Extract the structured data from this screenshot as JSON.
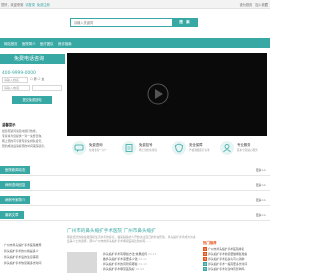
{
  "topbar": {
    "greeting": "您好，欢迎来到",
    "links": [
      "请登录",
      "免费注册"
    ],
    "right_links": [
      "设为首页",
      "加入收藏"
    ]
  },
  "search": {
    "placeholder": "请输入关键词",
    "button_label": "搜 索"
  },
  "nav": {
    "items": [
      "网站首页",
      "医院简介",
      "医疗团队",
      "就诊指南"
    ]
  },
  "sidebar": {
    "phone_title": "免费电话咨询",
    "hotline": "400-9999-0000",
    "name_placeholder": "请输入姓名",
    "phone_placeholder": "请输入电话",
    "radio_labels": [
      "男",
      "女"
    ],
    "submit_label": "提交免费回电",
    "notice_title": "温馨提示",
    "notice_lines": [
      "如您有疑问请及时拨打热线，",
      "专家将为您提供一对一免费咨询，",
      "网上预约可享受专家免排队挂号，",
      "预约成功后请按预约时间来院就诊。"
    ]
  },
  "services": [
    {
      "title": "免费咨询",
      "sub": "在线专家一对一",
      "icon": "chat-icon"
    },
    {
      "title": "免费挂号",
      "sub": "网上预约免排队",
      "icon": "clipboard-icon"
    },
    {
      "title": "安全保障",
      "sub": "严格遵循医疗标准",
      "icon": "shield-icon"
    },
    {
      "title": "专业服务",
      "sub": "医护全程贴心服务",
      "icon": "person-icon"
    }
  ],
  "sections": [
    {
      "label": "医院新闻动态",
      "more": "更多>>"
    },
    {
      "label": "病例咨询回复",
      "more": "更多>>"
    },
    {
      "label": "病例专家简介",
      "more": "更多>>"
    },
    {
      "label": "最新文章",
      "more": "更多>>"
    }
  ],
  "hero": {
    "title": "广州市的鼻头缩扩手术医院 广州市鼻头缩扩",
    "desc": "随着经济的快速发展和生活水平的提高，越来越多的人开始关注自己的外在形象，鼻头缩扩手术成为许多爱美人士的选择，那么广州市的鼻头缩扩手术哪家医院比较好呢……"
  },
  "left_news": [
    "· 广州市鼻头缩扩手术医院推荐",
    "· 鼻头缩扩手术的价格是多少",
    "· 鼻头缩扩手术后的注意事项",
    "· 鼻头缩扩手术恢复期多长时间"
  ],
  "mid_news": [
    {
      "title": "· 鼻头缩扩手术有哪些方法 效果如何",
      "date": "04-12"
    },
    {
      "title": "· 做鼻头缩扩手术需要多少钱",
      "date": "04-11"
    },
    {
      "title": "· 鼻头缩扩手术的风险有哪些",
      "date": "04-10"
    },
    {
      "title": "· 鼻头缩扩手术哪家医院好",
      "date": "04-09"
    }
  ],
  "right_list": {
    "title": "热门推荐",
    "items": [
      "广州市鼻头缩扩手术医院排名",
      "鼻头缩扩手术前需要做哪些准备",
      "鼻头缩扩手术后多久可以消肿",
      "鼻头缩扩手术一般需要多长时间",
      "鼻头缩扩手术对身体有影响吗",
      "鼻头缩扩手术失败了怎么办",
      "鼻头缩扩手术的最佳年龄"
    ]
  },
  "colors": {
    "accent": "#37a8a4",
    "hot": "#e8541e"
  }
}
